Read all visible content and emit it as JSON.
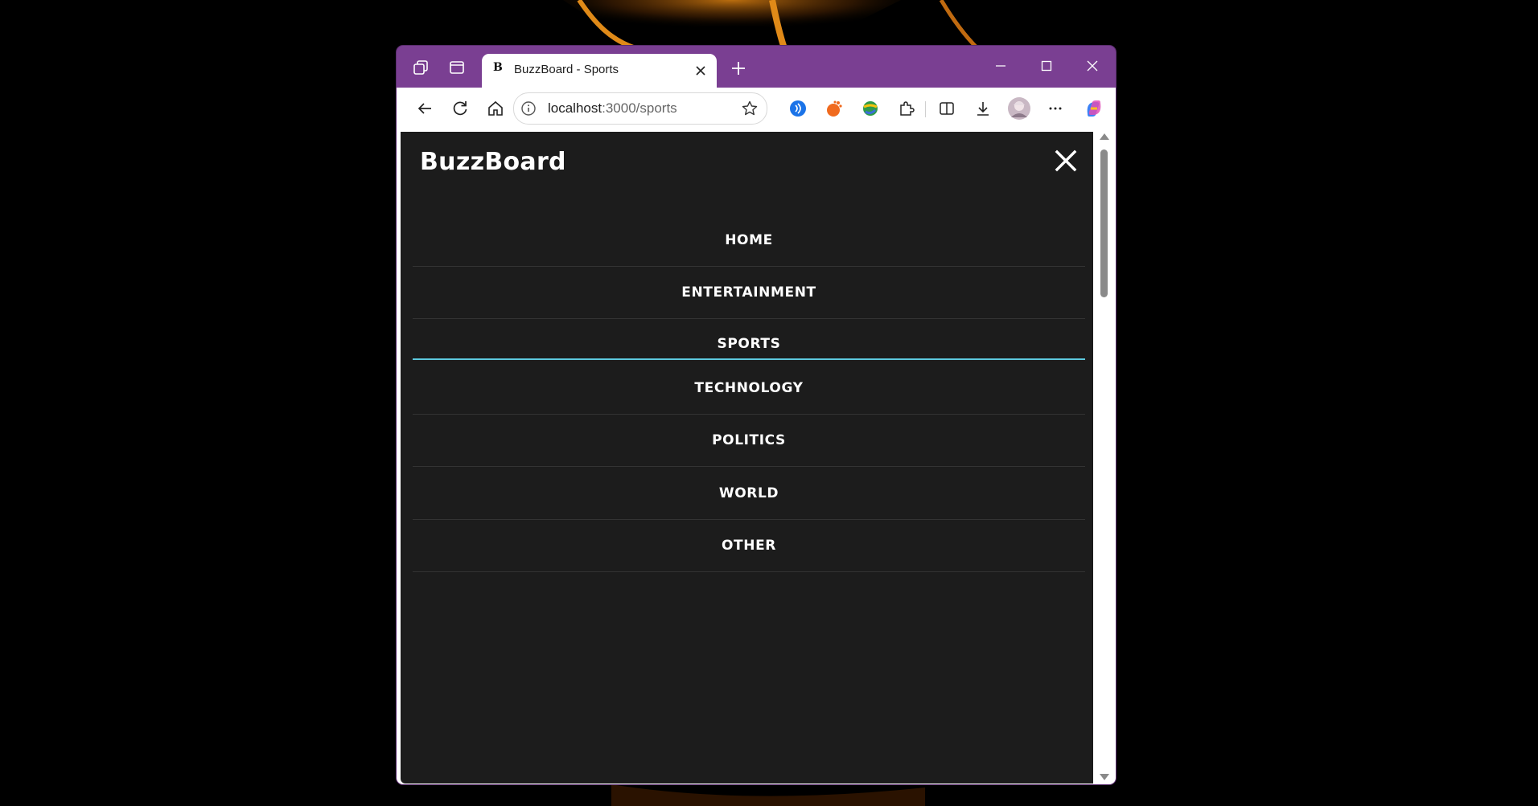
{
  "browser": {
    "tab_title": "BuzzBoard - Sports",
    "tab_favicon": "B",
    "url_host": "localhost",
    "url_path": ":3000/sports",
    "frame_color": "#7a3f92"
  },
  "site": {
    "brand": "BuzzBoard",
    "background_color": "#1c1c1c",
    "accent_color": "#5cc8dd",
    "menu_items": [
      {
        "label": "HOME",
        "active": false
      },
      {
        "label": "ENTERTAINMENT",
        "active": false
      },
      {
        "label": "SPORTS",
        "active": true
      },
      {
        "label": "TECHNOLOGY",
        "active": false
      },
      {
        "label": "POLITICS",
        "active": false
      },
      {
        "label": "WORLD",
        "active": false
      },
      {
        "label": "OTHER",
        "active": false
      }
    ]
  },
  "icons": {
    "workspaces": "workspaces-icon",
    "vertical_tabs": "tab-actions-icon",
    "back": "back-arrow-icon",
    "refresh": "refresh-icon",
    "home": "home-icon",
    "info": "site-info-icon",
    "favorite": "star-icon",
    "close_menu": "close-icon"
  }
}
